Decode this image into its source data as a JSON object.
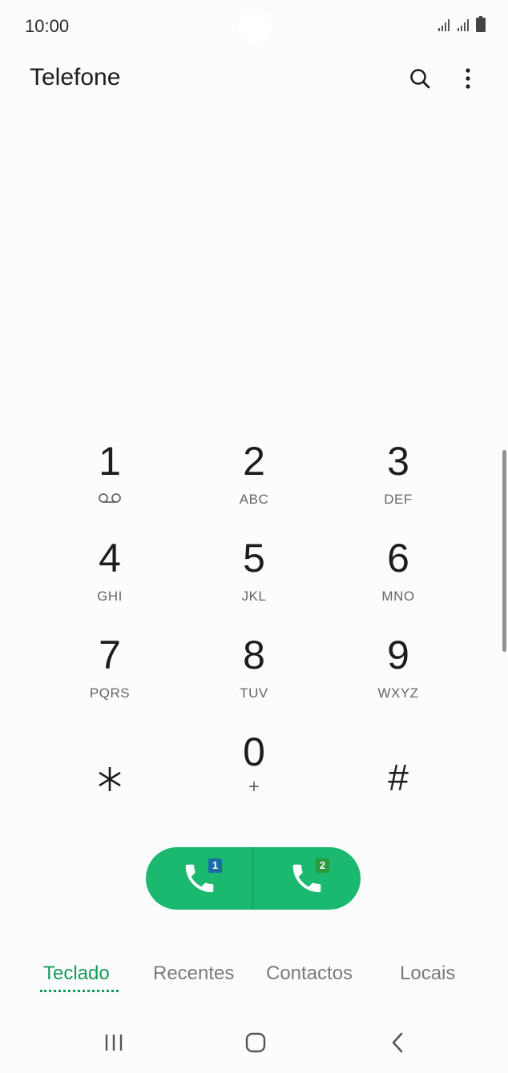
{
  "status_bar": {
    "time": "10:00"
  },
  "app_bar": {
    "title": "Telefone"
  },
  "keypad": {
    "keys": [
      {
        "digit": "1",
        "letters": ""
      },
      {
        "digit": "2",
        "letters": "ABC"
      },
      {
        "digit": "3",
        "letters": "DEF"
      },
      {
        "digit": "4",
        "letters": "GHI"
      },
      {
        "digit": "5",
        "letters": "JKL"
      },
      {
        "digit": "6",
        "letters": "MNO"
      },
      {
        "digit": "7",
        "letters": "PQRS"
      },
      {
        "digit": "8",
        "letters": "TUV"
      },
      {
        "digit": "9",
        "letters": "WXYZ"
      },
      {
        "digit": "*",
        "letters": ""
      },
      {
        "digit": "0",
        "letters": "+"
      },
      {
        "digit": "#",
        "letters": ""
      }
    ]
  },
  "call": {
    "sim1_badge": "1",
    "sim2_badge": "2",
    "accent_color": "#1bb870"
  },
  "tabs": [
    {
      "label": "Teclado",
      "active": true
    },
    {
      "label": "Recentes",
      "active": false
    },
    {
      "label": "Contactos",
      "active": false
    },
    {
      "label": "Locais",
      "active": false
    }
  ]
}
